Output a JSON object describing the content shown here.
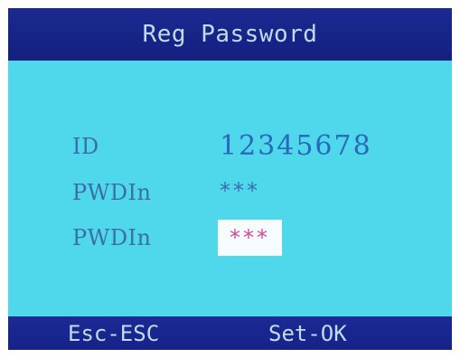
{
  "header": {
    "title": "Reg Password"
  },
  "form": {
    "fields": [
      {
        "label": "ID",
        "value": "12345678"
      },
      {
        "label": "PWDIn",
        "value": "***"
      },
      {
        "label": "PWDIn",
        "value": "***"
      }
    ]
  },
  "footer": {
    "esc_label": "Esc-ESC",
    "ok_label": "Set-OK"
  },
  "colors": {
    "frame": "#16248a",
    "content_bg": "#4fd7ec",
    "text_light": "#c4d9ea",
    "label_text": "#3a6ea9",
    "value_text": "#2a68bb",
    "focus_bg": "#f6fbfd",
    "focus_text": "#d04a9a"
  }
}
